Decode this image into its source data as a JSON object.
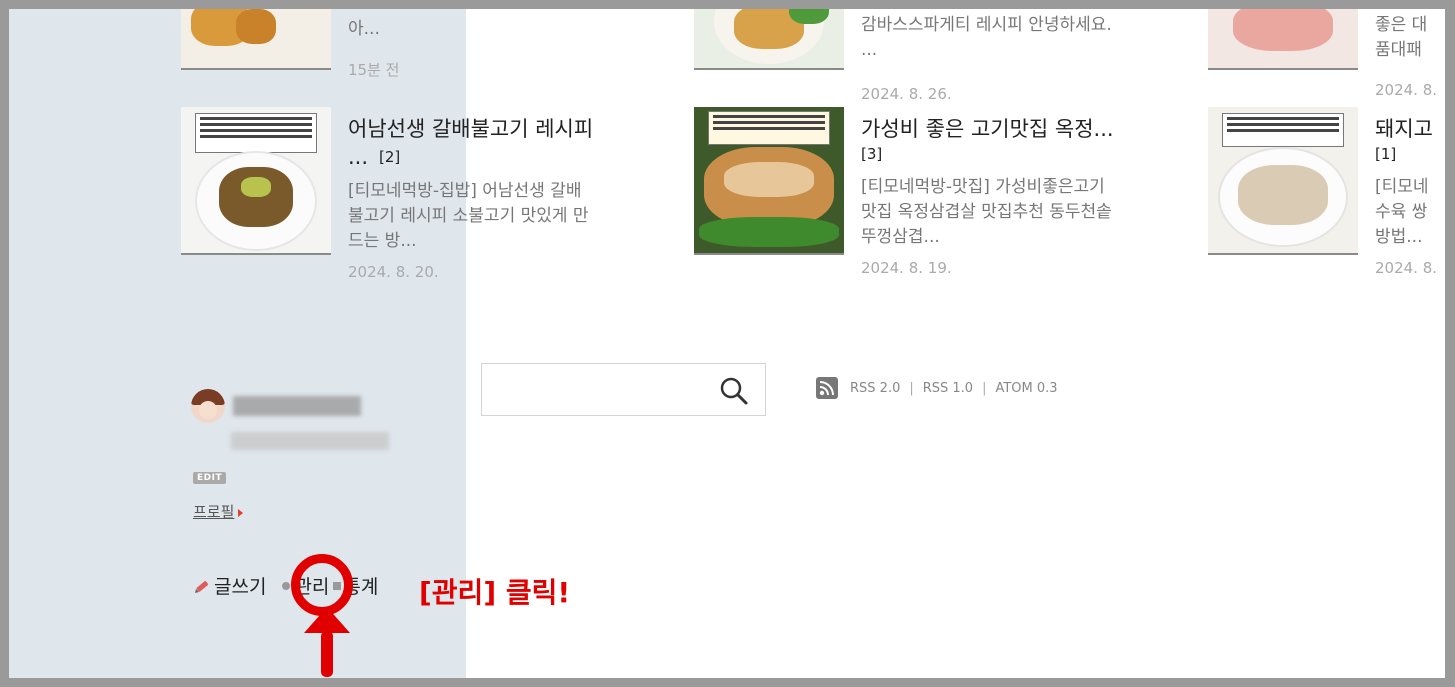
{
  "posts": [
    {
      "title": "",
      "count": "",
      "excerpt": [
        "",
        "아..."
      ],
      "date": "15분 전"
    },
    {
      "title": "",
      "count": "",
      "excerpt": [
        "",
        "감바스스파게티 레시피 안녕하세요.",
        "..."
      ],
      "date": "2024. 8. 26."
    },
    {
      "title": "",
      "count": "",
      "excerpt": [
        "좋은 대",
        "품대패"
      ],
      "date": "2024. 8."
    },
    {
      "title": "어남선생 갈배불고기 레시피",
      "title2": "...",
      "count": "[2]",
      "excerpt": [
        "[티모네먹방-집밥] 어남선생 갈배",
        "불고기 레시피 소불고기 맛있게 만",
        "드는 방..."
      ],
      "date": "2024. 8. 20."
    },
    {
      "title": "가성비 좋은 고기맛집 옥정...",
      "title2": "",
      "count": "[3]",
      "excerpt": [
        "[티모네먹방-맛집] 가성비좋은고기",
        "맛집 옥정삼겹살 맛집추천 동두천솥",
        "뚜껑삼겹..."
      ],
      "date": "2024. 8. 19."
    },
    {
      "title": "돼지고",
      "title2": "",
      "count": "[1]",
      "excerpt": [
        "[티모네",
        "수육 쌍",
        "방법..."
      ],
      "date": "2024. 8."
    }
  ],
  "search": {
    "placeholder": ""
  },
  "feeds": {
    "rss2": "RSS 2.0",
    "rss1": "RSS 1.0",
    "atom": "ATOM 0.3",
    "sep": "|"
  },
  "profile": {
    "edit_label": "EDIT",
    "profile_link": "프로필"
  },
  "admin": {
    "write": "글쓰기",
    "manage": "관리",
    "stats": "통계"
  },
  "annotation": {
    "text": "[관리] 클릭!"
  },
  "colors": {
    "accent_red": "#e00000",
    "sidebar_bg": "#dfe6ec"
  }
}
